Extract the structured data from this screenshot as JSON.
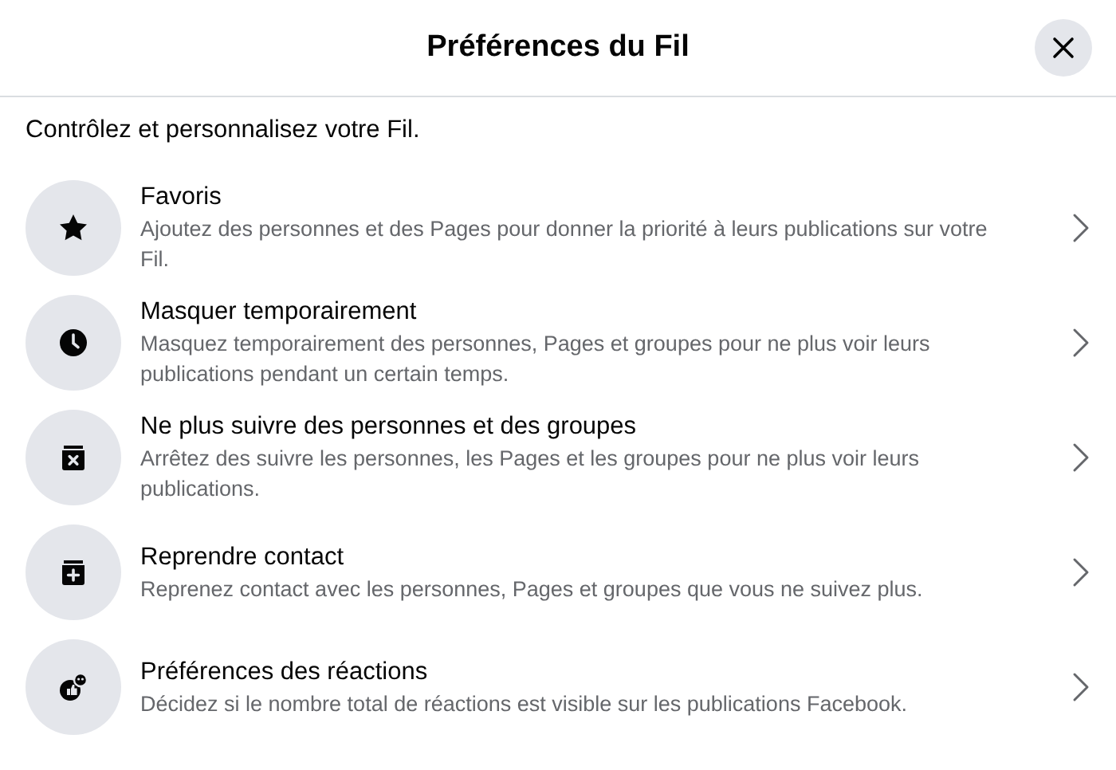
{
  "title": "Préférences du Fil",
  "intro": "Contrôlez et personnalisez votre Fil.",
  "items": [
    {
      "kind": "star",
      "title": "Favoris",
      "description": "Ajoutez des personnes et des Pages pour donner la priorité à leurs publications sur votre Fil."
    },
    {
      "kind": "clock",
      "title": "Masquer temporairement",
      "description": "Masquez temporairement des personnes, Pages et groupes pour ne plus voir leurs publications pendant un certain temps."
    },
    {
      "kind": "unfollow",
      "title": "Ne plus suivre des personnes et des groupes",
      "description": "Arrêtez des suivre les personnes, les Pages et les groupes pour ne plus voir leurs publications."
    },
    {
      "kind": "reconnect",
      "title": "Reprendre contact",
      "description": "Reprenez contact avec les personnes, Pages et groupes que vous ne suivez plus."
    },
    {
      "kind": "reactions",
      "title": "Préférences des réactions",
      "description": "Décidez si le nombre total de réactions est visible sur les publications Facebook."
    }
  ]
}
